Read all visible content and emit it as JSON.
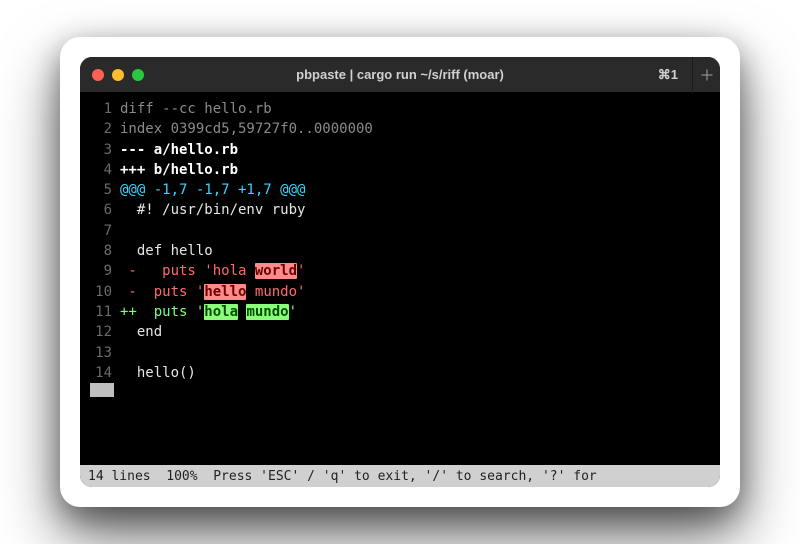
{
  "titlebar": {
    "title": "pbpaste | cargo run ~/s/riff (moar)",
    "shortcut": "⌘1"
  },
  "lines": {
    "n1": "1",
    "n2": "2",
    "n3": "3",
    "n4": "4",
    "n5": "5",
    "n6": "6",
    "n7": "7",
    "n8": "8",
    "n9": "9",
    "n10": "10",
    "n11": "11",
    "n12": "12",
    "n13": "13",
    "n14": "14",
    "l1": "diff --cc hello.rb",
    "l2": "index 0399cd5,59727f0..0000000",
    "l3_a": "--- a/",
    "l3_b": "hello.rb",
    "l4_a": "+++ b/",
    "l4_b": "hello.rb",
    "l5": "@@@ -1,7 -1,7 +1,7 @@@",
    "l6": "  #! /usr/bin/env ruby",
    "l8": "  def hello",
    "l9_marker": " -",
    "l9_a": "   puts '",
    "l9_b": "hola ",
    "l9_c": "world",
    "l9_d": "'",
    "l10_marker": " - ",
    "l10_a": " puts '",
    "l10_b": "hello",
    "l10_c": " mundo",
    "l10_d": "'",
    "l11_marker": "++",
    "l11_a": "  puts '",
    "l11_b": "hola",
    "l11_sp": " ",
    "l11_c": "mundo",
    "l11_d": "'",
    "l12": "  end",
    "l14": "  hello()"
  },
  "status": "14 lines  100%  Press 'ESC' / 'q' to exit, '/' to search, '?' for"
}
